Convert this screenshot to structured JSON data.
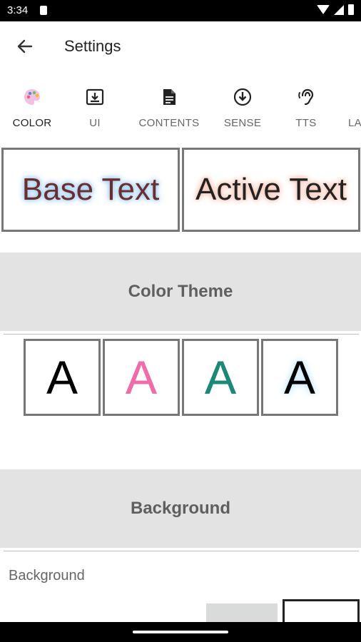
{
  "status_bar": {
    "time": "3:34"
  },
  "app_bar": {
    "title": "Settings",
    "back_icon": "arrow-left-icon"
  },
  "tabs": [
    {
      "label": "COLOR",
      "icon": "palette-icon",
      "active": true
    },
    {
      "label": "UI",
      "icon": "download-box-icon",
      "active": false
    },
    {
      "label": "CONTENTS",
      "icon": "document-icon",
      "active": false
    },
    {
      "label": "SENSE",
      "icon": "circle-arrow-down-icon",
      "active": false
    },
    {
      "label": "TTS",
      "icon": "ear-icon",
      "active": false
    },
    {
      "label": "LA",
      "icon": "",
      "active": false
    }
  ],
  "preview": {
    "base": "Base Text",
    "active": "Active Text"
  },
  "sections": {
    "color_theme": "Color Theme",
    "background": "Background"
  },
  "theme_options": [
    {
      "glyph": "A",
      "color": "#000000",
      "glow": "none"
    },
    {
      "glyph": "A",
      "color": "#f06ba8",
      "glow": "none"
    },
    {
      "glyph": "A",
      "color": "#188a77",
      "glow": "none"
    },
    {
      "glyph": "A",
      "color": "#000000",
      "glow": "#bfe3ff"
    }
  ],
  "background": {
    "label": "Background"
  },
  "colors": {
    "accent": "#1a73e8",
    "section_bg": "#e3e3e3",
    "base_text": "#6b2d2d",
    "base_glow": "#8bc3ef",
    "active_glow": "#f4b7a3"
  }
}
